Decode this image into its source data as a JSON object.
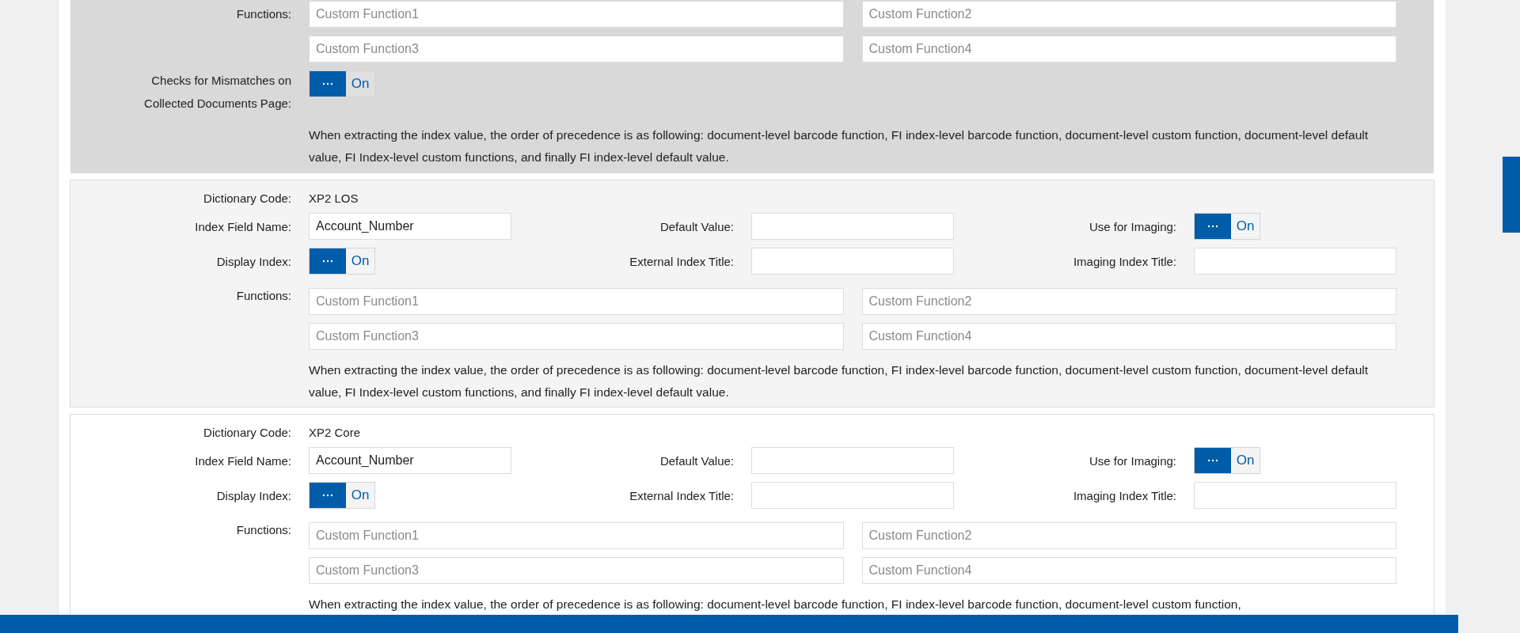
{
  "sections": [
    {
      "selected": true,
      "functions": {
        "label": "Functions:",
        "placeholders": [
          "Custom Function1",
          "Custom Function2",
          "Custom Function3",
          "Custom Function4"
        ]
      },
      "mismatch_check": {
        "label": "Checks for Mismatches on Collected Documents Page:",
        "toggle_label": "On",
        "on": true
      },
      "note": "When extracting the index value, the order of precedence is as following: document-level barcode function, FI index-level barcode function, document-level custom function, document-level default value, FI Index-level custom functions, and finally FI index-level default value."
    },
    {
      "selected": false,
      "dictionary_code": {
        "label": "Dictionary Code:",
        "value": "XP2 LOS"
      },
      "index_field_name": {
        "label": "Index Field Name:",
        "value": "Account_Number"
      },
      "default_value": {
        "label": "Default Value:"
      },
      "use_for_imaging": {
        "label": "Use for Imaging:",
        "toggle_label": "On",
        "on": true
      },
      "display_index": {
        "label": "Display Index:",
        "toggle_label": "On",
        "on": true
      },
      "external_index_title": {
        "label": "External Index Title:"
      },
      "imaging_index_title": {
        "label": "Imaging Index Title:"
      },
      "functions": {
        "label": "Functions:",
        "placeholders": [
          "Custom Function1",
          "Custom Function2",
          "Custom Function3",
          "Custom Function4"
        ]
      },
      "note": "When extracting the index value, the order of precedence is as following: document-level barcode function, FI index-level barcode function, document-level custom function, document-level default value, FI Index-level custom functions, and finally FI index-level default value."
    },
    {
      "selected": false,
      "dictionary_code": {
        "label": "Dictionary Code:",
        "value": "XP2 Core"
      },
      "index_field_name": {
        "label": "Index Field Name:",
        "value": "Account_Number"
      },
      "default_value": {
        "label": "Default Value:"
      },
      "use_for_imaging": {
        "label": "Use for Imaging:",
        "toggle_label": "On",
        "on": true
      },
      "display_index": {
        "label": "Display Index:",
        "toggle_label": "On",
        "on": true
      },
      "external_index_title": {
        "label": "External Index Title:"
      },
      "imaging_index_title": {
        "label": "Imaging Index Title:"
      },
      "functions": {
        "label": "Functions:",
        "placeholders": [
          "Custom Function1",
          "Custom Function2",
          "Custom Function3",
          "Custom Function4"
        ]
      },
      "note": "When extracting the index value, the order of precedence is as following: document-level barcode function, FI index-level barcode function, document-level custom function,"
    }
  ]
}
